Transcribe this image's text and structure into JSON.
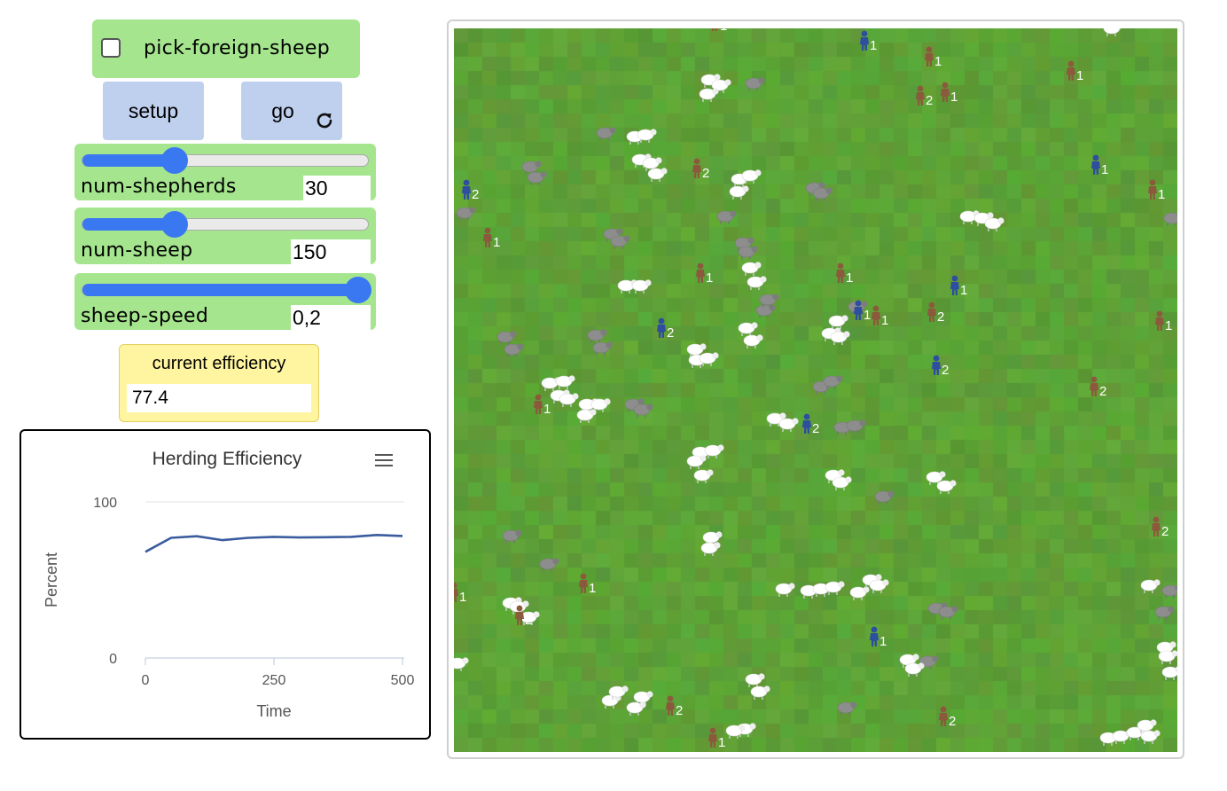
{
  "controls": {
    "switch": {
      "label": "pick-foreign-sheep",
      "checked": false
    },
    "setup_button": {
      "label": "setup"
    },
    "go_button": {
      "label": "go",
      "forever_icon": "refresh-icon"
    },
    "sliders": [
      {
        "name": "num-shepherds",
        "value": "30",
        "fraction": 0.32
      },
      {
        "name": "num-sheep",
        "value": "150",
        "fraction": 0.32
      },
      {
        "name": "sheep-speed",
        "value": "0,2",
        "fraction": 1.0
      }
    ]
  },
  "monitor": {
    "label": "current efficiency",
    "value": "77.4"
  },
  "plot": {
    "menu_icon": "hamburger-menu-icon",
    "line_color": "#3a5c9e",
    "chart_data": {
      "type": "line",
      "title": "Herding Efficiency",
      "xlabel": "Time",
      "ylabel": "Percent",
      "xlim": [
        0,
        500
      ],
      "ylim": [
        0,
        100
      ],
      "x_ticks": [
        "0",
        "250",
        "500"
      ],
      "y_ticks": [
        "0",
        "100"
      ],
      "series": [
        {
          "x": [
            0,
            50,
            100,
            150,
            200,
            250,
            300,
            350,
            400,
            450,
            500
          ],
          "values": [
            68,
            77,
            78,
            75.5,
            77,
            77.6,
            77.2,
            77.4,
            77.6,
            78.8,
            78.2
          ]
        }
      ]
    }
  },
  "world": {
    "patch_color": "#5ea43a",
    "white_sheep_color": "#ffffff",
    "gray_sheep_color": "#8d8d8d",
    "brown_shepherd_color": "#8b5a3c",
    "blue_shepherd_color": "#2e4e9e",
    "shepherds": [
      {
        "c": "blue",
        "l": "1",
        "x": 975,
        "y": 46
      },
      {
        "c": "brown",
        "l": "1",
        "x": 1048,
        "y": 64
      },
      {
        "c": "brown",
        "l": "2",
        "x": 1038,
        "y": 108
      },
      {
        "c": "brown",
        "l": "1",
        "x": 1066,
        "y": 104
      },
      {
        "c": "brown",
        "l": "1",
        "x": 1208,
        "y": 80
      },
      {
        "c": "brown",
        "l": "1",
        "x": 806,
        "y": 24
      },
      {
        "c": "brown",
        "l": "2",
        "x": 786,
        "y": 190
      },
      {
        "c": "blue",
        "l": "1",
        "x": 1236,
        "y": 186
      },
      {
        "c": "blue",
        "l": "2",
        "x": 526,
        "y": 214
      },
      {
        "c": "brown",
        "l": "1",
        "x": 1300,
        "y": 214
      },
      {
        "c": "brown",
        "l": "1",
        "x": 550,
        "y": 268
      },
      {
        "c": "brown",
        "l": "1",
        "x": 790,
        "y": 308
      },
      {
        "c": "brown",
        "l": "1",
        "x": 948,
        "y": 308
      },
      {
        "c": "blue",
        "l": "1",
        "x": 1077,
        "y": 322
      },
      {
        "c": "blue",
        "l": "1",
        "x": 968,
        "y": 350
      },
      {
        "c": "brown",
        "l": "1",
        "x": 988,
        "y": 356
      },
      {
        "c": "brown",
        "l": "2",
        "x": 1051,
        "y": 352
      },
      {
        "c": "brown",
        "l": "1",
        "x": 1308,
        "y": 362
      },
      {
        "c": "blue",
        "l": "2",
        "x": 746,
        "y": 370
      },
      {
        "c": "blue",
        "l": "2",
        "x": 1056,
        "y": 412
      },
      {
        "c": "brown",
        "l": "2",
        "x": 1234,
        "y": 436
      },
      {
        "c": "brown",
        "l": "1",
        "x": 607,
        "y": 456
      },
      {
        "c": "blue",
        "l": "2",
        "x": 910,
        "y": 478
      },
      {
        "c": "brown",
        "l": "2",
        "x": 1304,
        "y": 594
      },
      {
        "c": "brown",
        "l": "1",
        "x": 658,
        "y": 658
      },
      {
        "c": "brown",
        "l": "1",
        "x": 512,
        "y": 668
      },
      {
        "c": "brown",
        "l": "2",
        "x": 586,
        "y": 694
      },
      {
        "c": "blue",
        "l": "1",
        "x": 986,
        "y": 718
      },
      {
        "c": "brown",
        "l": "2",
        "x": 756,
        "y": 796
      },
      {
        "c": "brown",
        "l": "2",
        "x": 1064,
        "y": 808
      },
      {
        "c": "brown",
        "l": "1",
        "x": 804,
        "y": 832
      }
    ],
    "white_sheep": [
      [
        800,
        90
      ],
      [
        812,
        96
      ],
      [
        798,
        106
      ],
      [
        716,
        154
      ],
      [
        728,
        152
      ],
      [
        722,
        180
      ],
      [
        734,
        184
      ],
      [
        740,
        196
      ],
      [
        834,
        202
      ],
      [
        846,
        198
      ],
      [
        832,
        216
      ],
      [
        1092,
        244
      ],
      [
        1108,
        246
      ],
      [
        1120,
        252
      ],
      [
        846,
        302
      ],
      [
        852,
        318
      ],
      [
        706,
        322
      ],
      [
        722,
        322
      ],
      [
        944,
        362
      ],
      [
        936,
        376
      ],
      [
        946,
        380
      ],
      [
        842,
        370
      ],
      [
        848,
        384
      ],
      [
        784,
        394
      ],
      [
        786,
        406
      ],
      [
        798,
        404
      ],
      [
        620,
        432
      ],
      [
        636,
        430
      ],
      [
        630,
        446
      ],
      [
        640,
        450
      ],
      [
        662,
        456
      ],
      [
        676,
        456
      ],
      [
        660,
        468
      ],
      [
        874,
        472
      ],
      [
        888,
        478
      ],
      [
        790,
        510
      ],
      [
        804,
        508
      ],
      [
        784,
        520
      ],
      [
        792,
        536
      ],
      [
        940,
        536
      ],
      [
        948,
        544
      ],
      [
        1054,
        538
      ],
      [
        1066,
        548
      ],
      [
        802,
        606
      ],
      [
        800,
        618
      ],
      [
        884,
        664
      ],
      [
        912,
        666
      ],
      [
        926,
        664
      ],
      [
        940,
        662
      ],
      [
        968,
        668
      ],
      [
        982,
        654
      ],
      [
        990,
        660
      ],
      [
        1296,
        660
      ],
      [
        576,
        680
      ],
      [
        584,
        684
      ],
      [
        596,
        696
      ],
      [
        516,
        748
      ],
      [
        1024,
        744
      ],
      [
        1030,
        754
      ],
      [
        688,
        790
      ],
      [
        696,
        780
      ],
      [
        724,
        786
      ],
      [
        716,
        798
      ],
      [
        850,
        766
      ],
      [
        856,
        780
      ],
      [
        840,
        822
      ],
      [
        828,
        824
      ],
      [
        1250,
        832
      ],
      [
        1264,
        830
      ],
      [
        1280,
        826
      ],
      [
        1292,
        818
      ],
      [
        1296,
        830
      ],
      [
        1314,
        730
      ],
      [
        1316,
        740
      ],
      [
        1320,
        758
      ],
      [
        1254,
        32
      ]
    ],
    "gray_sheep": [
      [
        850,
        94
      ],
      [
        682,
        150
      ],
      [
        598,
        188
      ],
      [
        604,
        200
      ],
      [
        918,
        212
      ],
      [
        926,
        218
      ],
      [
        818,
        244
      ],
      [
        690,
        264
      ],
      [
        698,
        272
      ],
      [
        838,
        274
      ],
      [
        842,
        284
      ],
      [
        524,
        240
      ],
      [
        1322,
        246
      ],
      [
        862,
        350
      ],
      [
        866,
        338
      ],
      [
        966,
        346
      ],
      [
        570,
        380
      ],
      [
        578,
        394
      ],
      [
        672,
        378
      ],
      [
        678,
        392
      ],
      [
        714,
        456
      ],
      [
        724,
        462
      ],
      [
        926,
        436
      ],
      [
        938,
        430
      ],
      [
        950,
        482
      ],
      [
        964,
        480
      ],
      [
        996,
        560
      ],
      [
        576,
        604
      ],
      [
        618,
        636
      ],
      [
        1056,
        686
      ],
      [
        1068,
        690
      ],
      [
        1046,
        746
      ],
      [
        954,
        798
      ],
      [
        1312,
        690
      ],
      [
        1320,
        666
      ]
    ]
  }
}
